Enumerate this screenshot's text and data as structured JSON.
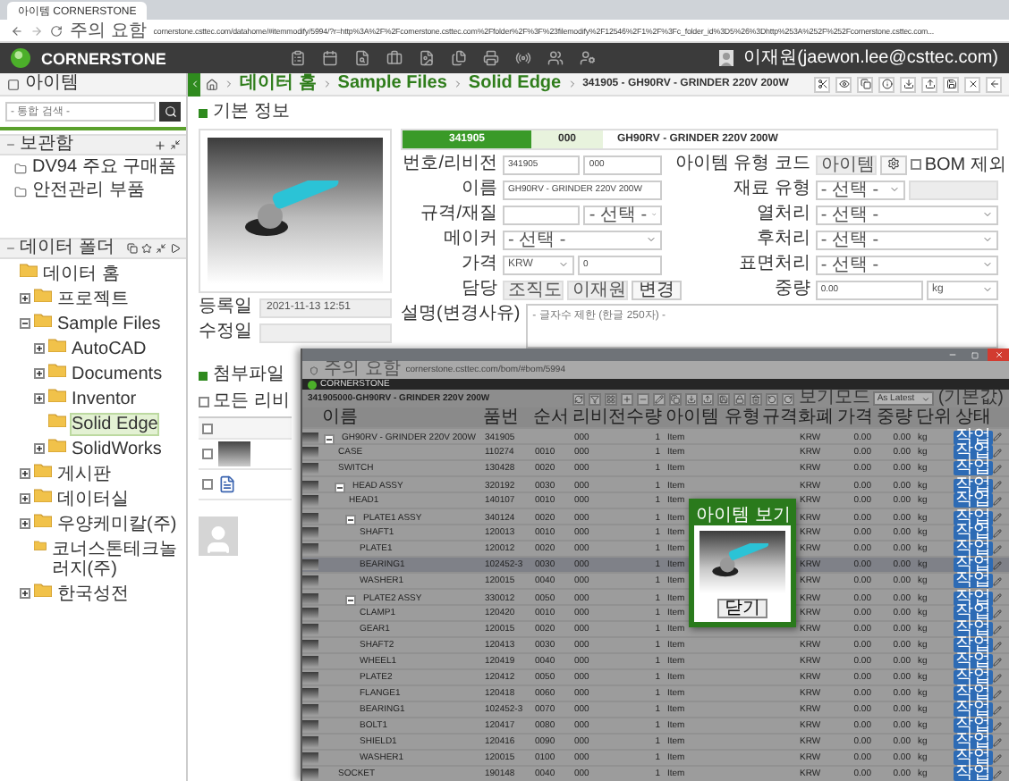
{
  "browser": {
    "tabs": [
      {
        "label": "아이템 CORNERSTONE",
        "selected": true
      }
    ],
    "warning": "주의 요함",
    "url": "cornerstone.csttec.com/datahome/#itemmodify/5994/?r=http%3A%2F%2Fcornerstone.csttec.com%2Ffolder%2F%3F%23filemodify%2F12546%2F1%2F%3Fc_folder_id%3D5%26%3Dhttp%253A%252F%252Fcornerstone.csttec.com..."
  },
  "app": {
    "logo": "CORNERSTONE",
    "user": "이재원(jaewon.lee@csttec.com)"
  },
  "sidebar": {
    "title": "아이템",
    "search": {
      "placeholder": "- 통합 검색 -"
    },
    "favorites": {
      "title": "보관함",
      "items": [
        "DV94 주요 구매품",
        "안전관리 부품"
      ]
    },
    "folders": {
      "title": "데이터 폴더",
      "tree": [
        {
          "label": "데이터 홈",
          "selected": false,
          "children": [
            {
              "label": "프로젝트",
              "expanded": false,
              "selected": false
            },
            {
              "label": "Sample Files",
              "expanded": true,
              "selected": false,
              "children": [
                {
                  "label": "AutoCAD",
                  "expanded": false,
                  "selected": false
                },
                {
                  "label": "Documents",
                  "expanded": false,
                  "selected": false
                },
                {
                  "label": "Inventor",
                  "expanded": false,
                  "selected": false
                },
                {
                  "label": "Solid Edge",
                  "selected": true
                },
                {
                  "label": "SolidWorks",
                  "expanded": false,
                  "selected": false
                }
              ]
            },
            {
              "label": "게시판",
              "expanded": false,
              "selected": false
            },
            {
              "label": "데이터실",
              "expanded": false,
              "selected": false
            },
            {
              "label": "우양케미칼(주)",
              "expanded": false,
              "selected": false
            },
            {
              "label": "코너스톤테크놀러지(주)",
              "selected": false
            },
            {
              "label": "한국성전",
              "expanded": false,
              "selected": false
            }
          ]
        }
      ]
    }
  },
  "breadcrumb": [
    "데이터 홈",
    "Sample Files",
    "Solid Edge",
    "341905 - GH90RV - GRINDER 220V 200W"
  ],
  "basic_info": {
    "title": "기본 정보",
    "number": "341905",
    "revision": "000",
    "name": "GH90RV - GRINDER 220V 200W",
    "dates": [
      {
        "label": "등록일",
        "value": "2021-11-13 12:51"
      },
      {
        "label": "수정일"
      }
    ],
    "fields": [
      {
        "label": "번호/리비전",
        "controls": [
          {
            "kind": "input",
            "value": "341905"
          },
          {
            "kind": "input",
            "value": "000"
          }
        ]
      },
      {
        "label": "아이템 유형 코드",
        "controls": [
          {
            "kind": "readonly",
            "value": "아이템"
          },
          {
            "kind": "gear"
          },
          {
            "kind": "checkbox",
            "label": "BOM 제외",
            "checked": false
          }
        ]
      },
      {
        "label": "이름",
        "controls": [
          {
            "kind": "input",
            "value": "GH90RV - GRINDER 220V 200W"
          }
        ]
      },
      {
        "label": "재료 유형",
        "controls": [
          {
            "kind": "select",
            "value": "- 선택 -"
          },
          {
            "kind": "readonly"
          }
        ]
      },
      {
        "label": "규격/재질",
        "controls": [
          {
            "kind": "input"
          },
          {
            "kind": "select",
            "value": "- 선택 -"
          }
        ]
      },
      {
        "label": "열처리",
        "controls": [
          {
            "kind": "select",
            "value": "- 선택 -"
          }
        ]
      },
      {
        "label": "메이커",
        "controls": [
          {
            "kind": "select",
            "value": "- 선택 -"
          }
        ]
      },
      {
        "label": "후처리",
        "controls": [
          {
            "kind": "select",
            "value": "- 선택 -"
          }
        ]
      },
      {
        "label": "가격",
        "controls": [
          {
            "kind": "select",
            "value": "KRW"
          },
          {
            "kind": "input",
            "value": "0"
          }
        ]
      },
      {
        "label": "표면처리",
        "controls": [
          {
            "kind": "select",
            "value": "- 선택 -"
          }
        ]
      },
      {
        "label": "담당",
        "controls": [
          {
            "kind": "readonly",
            "value": "조직도"
          },
          {
            "kind": "readonly",
            "value": "이재원"
          },
          {
            "kind": "button",
            "value": "변경"
          }
        ]
      },
      {
        "label": "중량",
        "controls": [
          {
            "kind": "input",
            "value": "0.00"
          },
          {
            "kind": "select",
            "value": "kg"
          }
        ]
      }
    ],
    "description": {
      "label": "설명(변경사유)",
      "placeholder": "- 글자수 제한 (한글 250자) -"
    }
  },
  "attachments": {
    "title": "첨부파일",
    "all_revisions": {
      "label": "모든 리비",
      "checked": false
    },
    "select_all": {
      "checked": false
    },
    "files": [
      {
        "kind": "image",
        "checked": false
      },
      {
        "kind": "document",
        "checked": false
      }
    ]
  },
  "bom_window": {
    "warning": "주의 요함",
    "url": "cornerstone.csttec.com/bom/#bom/5994",
    "logo": "CORNERSTONE",
    "title": "341905000-GH90RV - GRINDER 220V 200W",
    "view_mode_label": "보기모드",
    "view_mode": "As Latest",
    "default_label": "(기본값)",
    "columns": [
      "이름",
      "품번",
      "순서",
      "리비전",
      "수량",
      "아이템 유형",
      "규격",
      "화폐",
      "가격",
      "중량",
      "단위",
      "상태"
    ],
    "rows": [
      {
        "name": "GH90RV - GRINDER 220V 200W",
        "part_no": "341905",
        "rev": "000",
        "qty": "1",
        "type": "Item",
        "currency": "KRW",
        "price": "0.00",
        "weight": "0.00",
        "unit": "kg",
        "status": "작업",
        "selected": false,
        "expanded": true,
        "children": [
          {
            "name": "CASE",
            "part_no": "110274",
            "seq": "0010",
            "rev": "000",
            "qty": "1",
            "type": "Item",
            "currency": "KRW",
            "price": "0.00",
            "weight": "0.00",
            "unit": "kg",
            "status": "작업",
            "selected": false
          },
          {
            "name": "SWITCH",
            "part_no": "130428",
            "seq": "0020",
            "rev": "000",
            "qty": "1",
            "type": "Item",
            "currency": "KRW",
            "price": "0.00",
            "weight": "0.00",
            "unit": "kg",
            "status": "작업",
            "selected": false
          },
          {
            "name": "HEAD ASSY",
            "part_no": "320192",
            "seq": "0030",
            "rev": "000",
            "qty": "1",
            "type": "Item",
            "currency": "KRW",
            "price": "0.00",
            "weight": "0.00",
            "unit": "kg",
            "status": "작업",
            "selected": false,
            "expanded": true,
            "children": [
              {
                "name": "HEAD1",
                "part_no": "140107",
                "seq": "0010",
                "rev": "000",
                "qty": "1",
                "type": "Item",
                "currency": "KRW",
                "price": "0.00",
                "weight": "0.00",
                "unit": "kg",
                "status": "작업",
                "selected": false
              },
              {
                "name": "PLATE1 ASSY",
                "part_no": "340124",
                "seq": "0020",
                "rev": "000",
                "qty": "1",
                "type": "Item",
                "currency": "KRW",
                "price": "0.00",
                "weight": "0.00",
                "unit": "kg",
                "status": "작업",
                "selected": false,
                "expanded": true,
                "children": [
                  {
                    "name": "SHAFT1",
                    "part_no": "120013",
                    "seq": "0010",
                    "rev": "000",
                    "qty": "1",
                    "type": "Item",
                    "currency": "KRW",
                    "price": "0.00",
                    "weight": "0.00",
                    "unit": "kg",
                    "status": "작업",
                    "selected": false
                  },
                  {
                    "name": "PLATE1",
                    "part_no": "120012",
                    "seq": "0020",
                    "rev": "000",
                    "qty": "1",
                    "type": "Item",
                    "currency": "KRW",
                    "price": "0.00",
                    "weight": "0.00",
                    "unit": "kg",
                    "status": "작업",
                    "selected": false
                  },
                  {
                    "name": "BEARING1",
                    "part_no": "102452-3",
                    "seq": "0030",
                    "rev": "000",
                    "qty": "1",
                    "type": "Item",
                    "currency": "KRW",
                    "price": "0.00",
                    "weight": "0.00",
                    "unit": "kg",
                    "status": "작업",
                    "selected": true
                  },
                  {
                    "name": "WASHER1",
                    "part_no": "120015",
                    "seq": "0040",
                    "rev": "000",
                    "qty": "1",
                    "type": "Item",
                    "currency": "KRW",
                    "price": "0.00",
                    "weight": "0.00",
                    "unit": "kg",
                    "status": "작업",
                    "selected": false
                  }
                ]
              },
              {
                "name": "PLATE2 ASSY",
                "part_no": "330012",
                "seq": "0050",
                "rev": "000",
                "qty": "1",
                "type": "Item",
                "currency": "KRW",
                "price": "0.00",
                "weight": "0.00",
                "unit": "kg",
                "status": "작업",
                "selected": false,
                "expanded": true,
                "children": [
                  {
                    "name": "CLAMP1",
                    "part_no": "120420",
                    "seq": "0010",
                    "rev": "000",
                    "qty": "1",
                    "type": "Item",
                    "currency": "KRW",
                    "price": "0.00",
                    "weight": "0.00",
                    "unit": "kg",
                    "status": "작업",
                    "selected": false
                  },
                  {
                    "name": "GEAR1",
                    "part_no": "120015",
                    "seq": "0020",
                    "rev": "000",
                    "qty": "1",
                    "type": "Item",
                    "currency": "KRW",
                    "price": "0.00",
                    "weight": "0.00",
                    "unit": "kg",
                    "status": "작업",
                    "selected": false
                  },
                  {
                    "name": "SHAFT2",
                    "part_no": "120413",
                    "seq": "0030",
                    "rev": "000",
                    "qty": "1",
                    "type": "Item",
                    "currency": "KRW",
                    "price": "0.00",
                    "weight": "0.00",
                    "unit": "kg",
                    "status": "작업",
                    "selected": false
                  },
                  {
                    "name": "WHEEL1",
                    "part_no": "120419",
                    "seq": "0040",
                    "rev": "000",
                    "qty": "1",
                    "type": "Item",
                    "currency": "KRW",
                    "price": "0.00",
                    "weight": "0.00",
                    "unit": "kg",
                    "status": "작업",
                    "selected": false
                  },
                  {
                    "name": "PLATE2",
                    "part_no": "120412",
                    "seq": "0050",
                    "rev": "000",
                    "qty": "1",
                    "type": "Item",
                    "currency": "KRW",
                    "price": "0.00",
                    "weight": "0.00",
                    "unit": "kg",
                    "status": "작업",
                    "selected": false
                  },
                  {
                    "name": "FLANGE1",
                    "part_no": "120418",
                    "seq": "0060",
                    "rev": "000",
                    "qty": "1",
                    "type": "Item",
                    "currency": "KRW",
                    "price": "0.00",
                    "weight": "0.00",
                    "unit": "kg",
                    "status": "작업",
                    "selected": false
                  },
                  {
                    "name": "BEARING1",
                    "part_no": "102452-3",
                    "seq": "0070",
                    "rev": "000",
                    "qty": "1",
                    "type": "Item",
                    "currency": "KRW",
                    "price": "0.00",
                    "weight": "0.00",
                    "unit": "kg",
                    "status": "작업",
                    "selected": false
                  },
                  {
                    "name": "BOLT1",
                    "part_no": "120417",
                    "seq": "0080",
                    "rev": "000",
                    "qty": "1",
                    "type": "Item",
                    "currency": "KRW",
                    "price": "0.00",
                    "weight": "0.00",
                    "unit": "kg",
                    "status": "작업",
                    "selected": false
                  },
                  {
                    "name": "SHIELD1",
                    "part_no": "120416",
                    "seq": "0090",
                    "rev": "000",
                    "qty": "1",
                    "type": "Item",
                    "currency": "KRW",
                    "price": "0.00",
                    "weight": "0.00",
                    "unit": "kg",
                    "status": "작업",
                    "selected": false
                  },
                  {
                    "name": "WASHER1",
                    "part_no": "120015",
                    "seq": "0100",
                    "rev": "000",
                    "qty": "1",
                    "type": "Item",
                    "currency": "KRW",
                    "price": "0.00",
                    "weight": "0.00",
                    "unit": "kg",
                    "status": "작업",
                    "selected": false
                  }
                ]
              }
            ]
          },
          {
            "name": "SOCKET",
            "part_no": "190148",
            "seq": "0040",
            "rev": "000",
            "qty": "1",
            "type": "Item",
            "currency": "KRW",
            "price": "0.00",
            "weight": "0.00",
            "unit": "kg",
            "status": "작업",
            "selected": false
          }
        ]
      }
    ],
    "popup": {
      "title": "아이템 보기",
      "button": "닫기"
    }
  }
}
